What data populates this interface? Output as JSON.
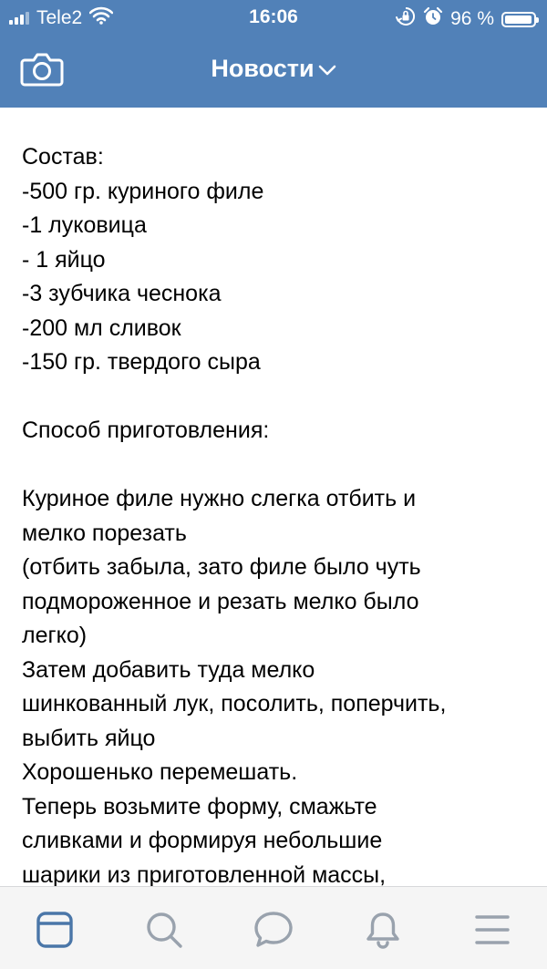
{
  "status_bar": {
    "carrier": "Tele2",
    "time": "16:06",
    "battery_percent_label": "96 %",
    "battery_level": 0.96,
    "icons": [
      "signal-icon",
      "wifi-icon",
      "rotation-lock-icon",
      "alarm-icon",
      "battery-icon"
    ]
  },
  "nav": {
    "title": "Новости",
    "left_icon": "camera-icon",
    "title_icon": "chevron-down-icon"
  },
  "post": {
    "lines": [
      "Состав:",
      "-500 гр. куриного филе",
      "-1 луковица",
      "- 1 яйцо",
      "-3 зубчика чеснока",
      "-200 мл сливок",
      "-150 гр. твердого сыра",
      "",
      "Способ приготовления:",
      "",
      "Куриное филе нужно слегка отбить и",
      "мелко порезать",
      "(отбить забыла, зато филе было чуть",
      "подмороженное и резать мелко было",
      "легко)",
      "Затем добавить туда мелко",
      "шинкованный лук, посолить, поперчить,",
      "выбить яйцо",
      "Хорошенько перемешать.",
      "Теперь возьмите форму, смажьте",
      "сливками и формируя небольшие",
      "шарики из приготовленной массы,"
    ]
  },
  "tabbar": {
    "tabs": [
      {
        "name": "news",
        "icon": "news-feed-icon",
        "active": true
      },
      {
        "name": "search",
        "icon": "search-icon",
        "active": false
      },
      {
        "name": "messages",
        "icon": "message-bubble-icon",
        "active": false
      },
      {
        "name": "notifications",
        "icon": "bell-icon",
        "active": false
      },
      {
        "name": "menu",
        "icon": "menu-icon",
        "active": false
      }
    ]
  },
  "colors": {
    "header_bg": "#5181b8",
    "tab_active": "#4a76a8",
    "tab_inactive": "#99a2ad",
    "tabbar_bg": "#f5f5f5"
  }
}
